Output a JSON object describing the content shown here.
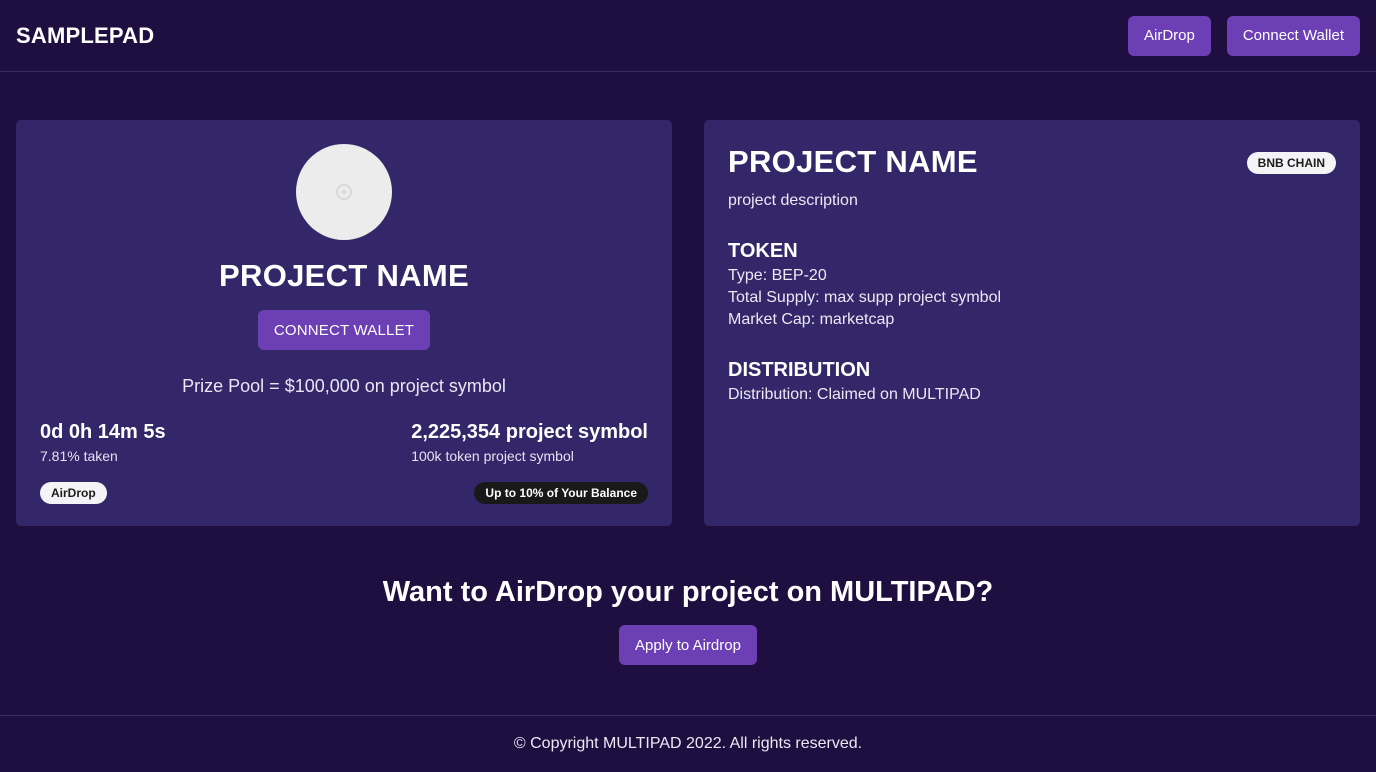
{
  "header": {
    "brand": "SAMPLEPAD",
    "airdrop_label": "AirDrop",
    "connect_label": "Connect Wallet"
  },
  "colors": {
    "background": "#1e0f40",
    "card": "#33276a",
    "accent": "#6c3fb5"
  },
  "left_card": {
    "avatar_icon": "image-placeholder-icon",
    "title": "PROJECT NAME",
    "connect_label": "CONNECT WALLET",
    "prize_pool": "Prize Pool = $100,000 on project symbol",
    "countdown": "0d 0h 14m 5s",
    "taken": "7.81% taken",
    "amount": "2,225,354 project symbol",
    "amount_sub": "100k token project symbol",
    "badge_type": "AirDrop",
    "badge_limit": "Up to 10% of Your Balance"
  },
  "right_card": {
    "title": "PROJECT NAME",
    "chain": "BNB CHAIN",
    "description": "project description",
    "token_heading": "TOKEN",
    "token_type": "Type: BEP-20",
    "total_supply": "Total Supply: max supp project symbol",
    "market_cap": "Market Cap: marketcap",
    "distribution_heading": "DISTRIBUTION",
    "distribution": "Distribution: Claimed on MULTIPAD"
  },
  "cta": {
    "title": "Want to AirDrop your project on MULTIPAD?",
    "apply_label": "Apply to Airdrop"
  },
  "footer": {
    "copyright": "© Copyright MULTIPAD 2022. All rights reserved."
  }
}
